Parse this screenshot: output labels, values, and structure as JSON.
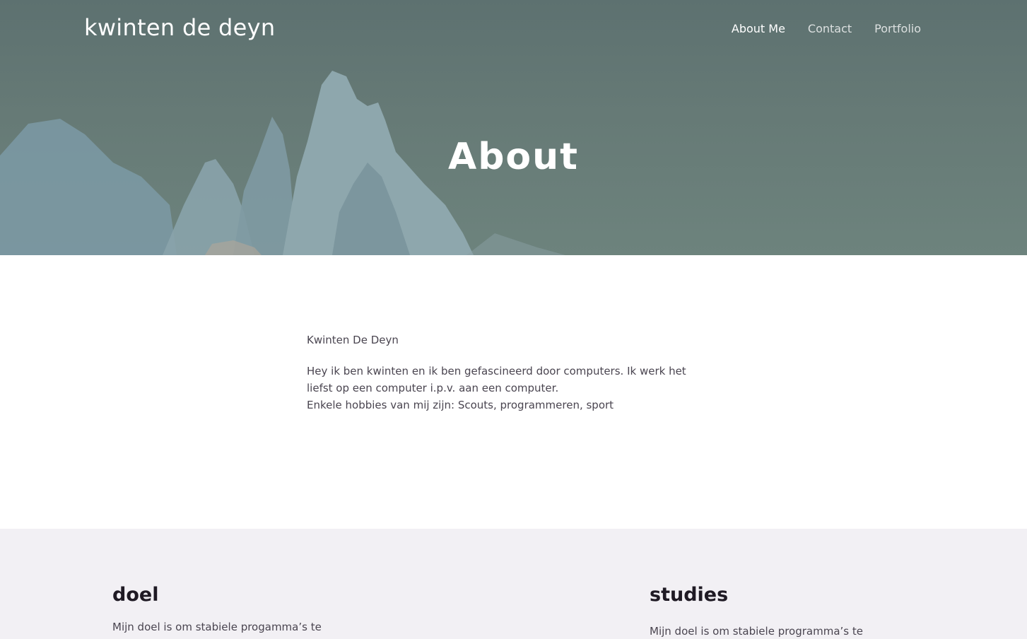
{
  "header": {
    "site_title": "kwinten de deyn",
    "nav": [
      {
        "label": "About Me",
        "active": true
      },
      {
        "label": "Contact",
        "active": false
      },
      {
        "label": "Portfolio",
        "active": false
      }
    ]
  },
  "hero": {
    "title": "About"
  },
  "about": {
    "name": "Kwinten De Deyn",
    "bio_line1": "Hey ik ben kwinten en ik ben gefascineerd door computers. Ik werk het liefst op een computer i.p.v. aan een computer.",
    "bio_line2": "Enkele hobbies van mij zijn: Scouts, programmeren, sport"
  },
  "sections": {
    "doel": {
      "heading": "doel",
      "text": "Mijn doel is om stabiele progamma’s te"
    },
    "studies": {
      "heading": "studies",
      "text": "Mijn doel is om stabiele programma’s te"
    }
  },
  "colors": {
    "hero_overlay": "#667a76",
    "text": "#4a4550",
    "heading": "#1f1a24",
    "section_bg": "#f2f0f4"
  }
}
